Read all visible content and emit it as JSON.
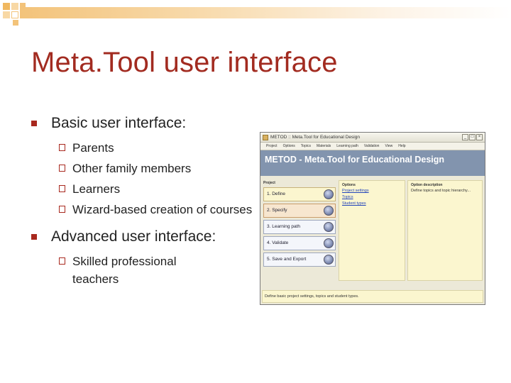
{
  "slide": {
    "title": "Meta.Tool user interface",
    "accent_color": "#a22b20"
  },
  "bullets": [
    {
      "text": "Basic user interface:",
      "items": [
        "Parents",
        "Other family members",
        "Learners",
        "Wizard-based creation of courses"
      ]
    },
    {
      "text": "Advanced user interface:",
      "items": [
        "Skilled professional teachers"
      ]
    }
  ],
  "app": {
    "window_title": "METOD :: Meta.Tool for Educational Design",
    "menu": [
      "Project",
      "Options",
      "Topics",
      "Materials",
      "Learning path",
      "Validation",
      "View",
      "Help"
    ],
    "header": "METOD - Meta.Tool for Educational Design",
    "columns": {
      "project": "Project",
      "options": "Options",
      "description": "Option description"
    },
    "steps": [
      "1. Define",
      "2. Specify",
      "3. Learning path",
      "4. Validate",
      "5. Save and Export"
    ],
    "option_links": [
      "Project settings",
      "Topics",
      "Student types"
    ],
    "option_description": "Define topics and topic hierarchy...",
    "status": "Define basic project settings, topics and student types.",
    "header_color": "#8294ae"
  }
}
